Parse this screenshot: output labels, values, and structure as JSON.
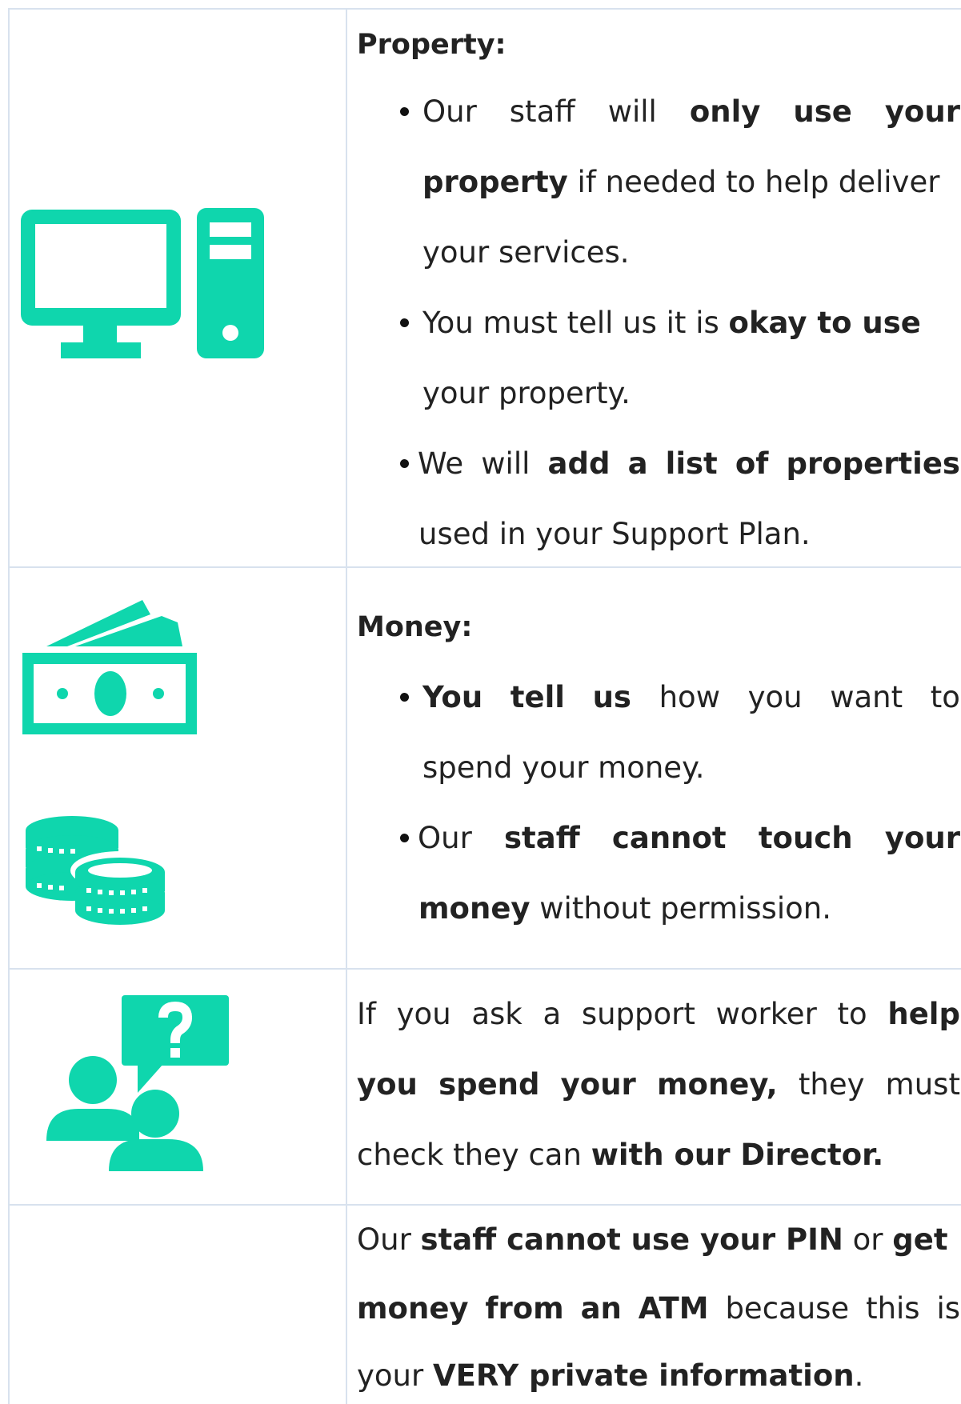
{
  "colors": {
    "accent": "#0fd6ad",
    "grid": "#d8e2ee"
  },
  "property": {
    "heading": "Property:",
    "b1": {
      "w1": "Our",
      "w2": "staff",
      "w3": "will",
      "w4": "only",
      "w5": "use",
      "w6": "your",
      "l2_bold": "property",
      "l2_rest": " if needed to help deliver",
      "l3": "your services."
    },
    "b2": {
      "pre": "You must tell us it is ",
      "bold": "okay to use",
      "l2": "your property."
    },
    "b3": {
      "w1": "We",
      "w2": "will",
      "w3": "add",
      "w4": "a",
      "w5": "list",
      "w6": "of",
      "w7": "properties",
      "l2": "used in your Support Plan."
    }
  },
  "money": {
    "heading": "Money:",
    "b1": {
      "w1": "You",
      "w2": "tell",
      "w3": "us",
      "w4": "how",
      "w5": "you",
      "w6": "want",
      "w7": "to",
      "l2": "spend your money."
    },
    "b2": {
      "w1": "Our",
      "w2": "staff",
      "w3": "cannot",
      "w4": "touch",
      "w5": "your",
      "l2_bold": "money",
      "l2_rest": " without permission."
    }
  },
  "ask": {
    "w1": "If",
    "w2": "you",
    "w3": "ask",
    "w4": "a",
    "w5": "support",
    "w6": "worker",
    "w7": "to",
    "w8": "help",
    "l2_w1": "you",
    "l2_w2": "spend",
    "l2_w3": "your",
    "l2_w4": "money,",
    "l2_w5": "they",
    "l2_w6": "must",
    "l3_pre": "check they can ",
    "l3_bold": "with our Director."
  },
  "pin": {
    "l1_pre": "Our ",
    "l1_b1": "staff cannot use your PIN",
    "l1_mid": " or ",
    "l1_b2": "get",
    "l2_w1": "money",
    "l2_w2": "from",
    "l2_w3": "an",
    "l2_w4": "ATM",
    "l2_w5": "because",
    "l2_w6": "this",
    "l2_w7": "is",
    "l3_pre": "your ",
    "l3_bold": "VERY private information",
    "l3_post": "."
  },
  "icons": [
    "computer-icon",
    "banknotes-icon",
    "coins-icon",
    "question-people-icon"
  ]
}
